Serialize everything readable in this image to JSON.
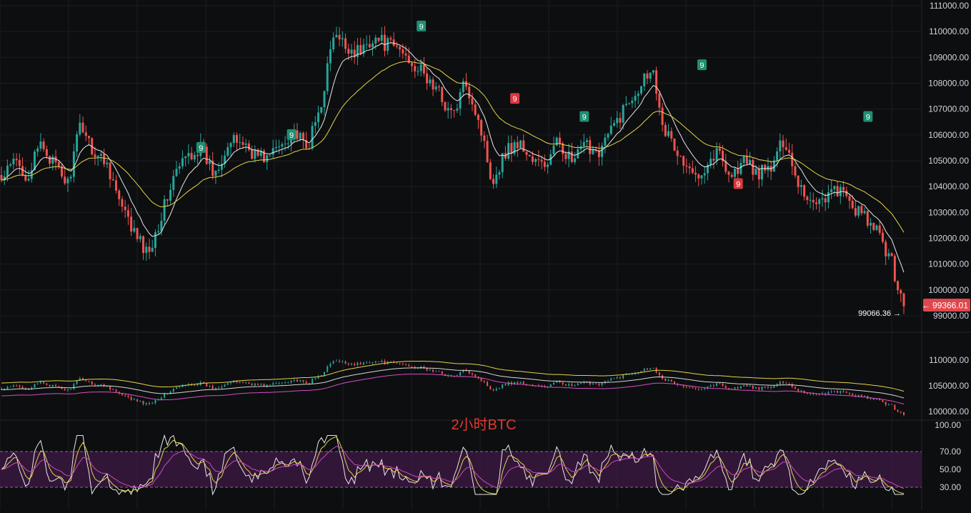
{
  "chart_data": [
    {
      "type": "candlestick",
      "name": "",
      "ylim": [
        99000,
        111000
      ],
      "y_ticks": [
        "111000.00",
        "110000.00",
        "109000.00",
        "108000.00",
        "107000.00",
        "106000.00",
        "105000.00",
        "104000.00",
        "103000.00",
        "102000.00",
        "101000.00",
        "100000.00",
        "99000.00"
      ],
      "y_tick_values": [
        111000,
        110000,
        109000,
        108000,
        107000,
        106000,
        105000,
        104000,
        103000,
        102000,
        101000,
        100000,
        99000
      ],
      "ohlc_close_anchors": [
        104200,
        105000,
        104400,
        105700,
        104800,
        104100,
        106500,
        105300,
        104900,
        103200,
        102200,
        101400,
        102800,
        104400,
        105200,
        105500,
        104500,
        105600,
        105800,
        105300,
        105100,
        105600,
        106200,
        105400,
        107000,
        109800,
        109400,
        109200,
        109800,
        109500,
        109300,
        108800,
        108200,
        107600,
        106700,
        108100,
        106500,
        104200,
        105400,
        105700,
        105000,
        104800,
        105800,
        104900,
        105600,
        105400,
        106200,
        107100,
        107900,
        108700,
        106200,
        105200,
        104400,
        104800,
        105400,
        104400,
        105000,
        104500,
        104700,
        105900,
        104200,
        103400,
        103600,
        103900,
        103300,
        102800,
        102200,
        101200,
        99366
      ],
      "series": [
        {
          "name": "",
          "color": "#e8e8e8"
        },
        {
          "name": "",
          "color": "#e5d44a"
        }
      ],
      "markers": [
        {
          "label": "9",
          "kind": "up",
          "x": 66,
          "price": 105500
        },
        {
          "label": "9",
          "kind": "up",
          "x": 96,
          "price": 106000
        },
        {
          "label": "9",
          "kind": "up",
          "x": 139,
          "price": 110200
        },
        {
          "label": "9",
          "kind": "down",
          "x": 170,
          "price": 107400
        },
        {
          "label": "9",
          "kind": "up",
          "x": 193,
          "price": 106700
        },
        {
          "label": "9",
          "kind": "up",
          "x": 232,
          "price": 108700
        },
        {
          "label": "9",
          "kind": "down",
          "x": 244,
          "price": 104100
        },
        {
          "label": "9",
          "kind": "up",
          "x": 287,
          "price": 106700
        }
      ],
      "last_price_label": "99366.01",
      "last_price": 99366.01,
      "low_annotation": "99066.36 →",
      "low_price": 99066.36,
      "colors": {
        "up": "#26a69a",
        "down": "#ef5350",
        "marker_up": "#1f8f72",
        "marker_down": "#d9383e",
        "price_tag": "#e0474c"
      }
    },
    {
      "type": "candlestick_with_bands",
      "ylim": [
        100000,
        110000
      ],
      "y_ticks": [
        "110000.00",
        "105000.00",
        "100000.00"
      ],
      "y_tick_values": [
        110000,
        105000,
        100000
      ],
      "series": [
        {
          "name": "",
          "color": "#e5d44a"
        },
        {
          "name": "",
          "color": "#d8d8d8"
        },
        {
          "name": "",
          "color": "#d64fc8"
        }
      ],
      "watermark": "2小时BTC"
    },
    {
      "type": "line",
      "ylim": [
        20,
        100
      ],
      "y_ticks": [
        "100.00",
        "70.00",
        "50.00",
        "30.00"
      ],
      "y_tick_values": [
        100,
        70,
        50,
        30
      ],
      "band": [
        30,
        70
      ],
      "band_color": "#3a1840",
      "series": [
        {
          "name": "",
          "color": "#e8e8e8"
        },
        {
          "name": "",
          "color": "#e5d44a"
        },
        {
          "name": "",
          "color": "#c94bc0"
        }
      ]
    }
  ]
}
